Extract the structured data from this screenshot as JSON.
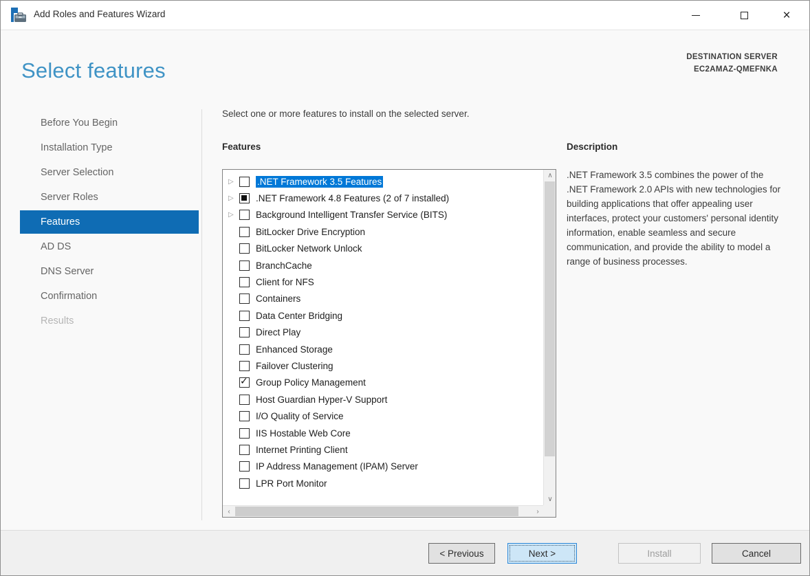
{
  "window": {
    "title": "Add Roles and Features Wizard",
    "icon": "server-manager-icon",
    "controls": {
      "minimize": "minimize-icon",
      "maximize": "maximize-icon",
      "close_glyph": "×"
    }
  },
  "header": {
    "title": "Select features",
    "destination_label": "DESTINATION SERVER",
    "destination_server": "EC2AMAZ-QMEFNKA"
  },
  "sidebar": {
    "items": [
      {
        "label": "Before You Begin",
        "state": "normal"
      },
      {
        "label": "Installation Type",
        "state": "normal"
      },
      {
        "label": "Server Selection",
        "state": "normal"
      },
      {
        "label": "Server Roles",
        "state": "normal"
      },
      {
        "label": "Features",
        "state": "selected"
      },
      {
        "label": "AD DS",
        "state": "normal"
      },
      {
        "label": "DNS Server",
        "state": "normal"
      },
      {
        "label": "Confirmation",
        "state": "normal"
      },
      {
        "label": "Results",
        "state": "disabled"
      }
    ]
  },
  "main": {
    "instruction": "Select one or more features to install on the selected server.",
    "features_label": "Features",
    "description_label": "Description",
    "description_text": ".NET Framework 3.5 combines the power of the .NET Framework 2.0 APIs with new technologies for building applications that offer appealing user interfaces, protect your customers' personal identity information, enable seamless and secure communication, and provide the ability to model a range of business processes.",
    "features": [
      {
        "label": ".NET Framework 3.5 Features",
        "state": "unchecked",
        "expandable": true,
        "selected": true
      },
      {
        "label": ".NET Framework 4.8 Features (2 of 7 installed)",
        "state": "partial",
        "expandable": true,
        "selected": false
      },
      {
        "label": "Background Intelligent Transfer Service (BITS)",
        "state": "unchecked",
        "expandable": true,
        "selected": false
      },
      {
        "label": "BitLocker Drive Encryption",
        "state": "unchecked",
        "expandable": false,
        "selected": false
      },
      {
        "label": "BitLocker Network Unlock",
        "state": "unchecked",
        "expandable": false,
        "selected": false
      },
      {
        "label": "BranchCache",
        "state": "unchecked",
        "expandable": false,
        "selected": false
      },
      {
        "label": "Client for NFS",
        "state": "unchecked",
        "expandable": false,
        "selected": false
      },
      {
        "label": "Containers",
        "state": "unchecked",
        "expandable": false,
        "selected": false
      },
      {
        "label": "Data Center Bridging",
        "state": "unchecked",
        "expandable": false,
        "selected": false
      },
      {
        "label": "Direct Play",
        "state": "unchecked",
        "expandable": false,
        "selected": false
      },
      {
        "label": "Enhanced Storage",
        "state": "unchecked",
        "expandable": false,
        "selected": false
      },
      {
        "label": "Failover Clustering",
        "state": "unchecked",
        "expandable": false,
        "selected": false
      },
      {
        "label": "Group Policy Management",
        "state": "checked",
        "expandable": false,
        "selected": false
      },
      {
        "label": "Host Guardian Hyper-V Support",
        "state": "unchecked",
        "expandable": false,
        "selected": false
      },
      {
        "label": "I/O Quality of Service",
        "state": "unchecked",
        "expandable": false,
        "selected": false
      },
      {
        "label": "IIS Hostable Web Core",
        "state": "unchecked",
        "expandable": false,
        "selected": false
      },
      {
        "label": "Internet Printing Client",
        "state": "unchecked",
        "expandable": false,
        "selected": false
      },
      {
        "label": "IP Address Management (IPAM) Server",
        "state": "unchecked",
        "expandable": false,
        "selected": false
      },
      {
        "label": "LPR Port Monitor",
        "state": "unchecked",
        "expandable": false,
        "selected": false
      }
    ],
    "scrollbar_icons": {
      "up": "∧",
      "down": "∨",
      "left": "‹",
      "right": "›"
    },
    "expand_glyph": "▷",
    "check_glyph": "✓"
  },
  "footer": {
    "buttons": [
      {
        "label": "< Previous",
        "style": "normal",
        "name": "previous-button",
        "id": "btn-previous"
      },
      {
        "label": "Next >",
        "style": "default",
        "name": "next-button",
        "id": "btn-next"
      },
      {
        "label": "Install",
        "style": "disabled",
        "name": "install-button",
        "id": "btn-install"
      },
      {
        "label": "Cancel",
        "style": "normal",
        "name": "cancel-button",
        "id": "btn-cancel"
      }
    ]
  },
  "colors": {
    "heading_blue": "#3f93c5",
    "nav_selected_bg": "#0f6cb4",
    "list_selection_bg": "#0078d7",
    "next_button_bg": "#cde6f7",
    "next_button_border": "#2c88d8",
    "footer_bg": "#f0f0f0"
  }
}
